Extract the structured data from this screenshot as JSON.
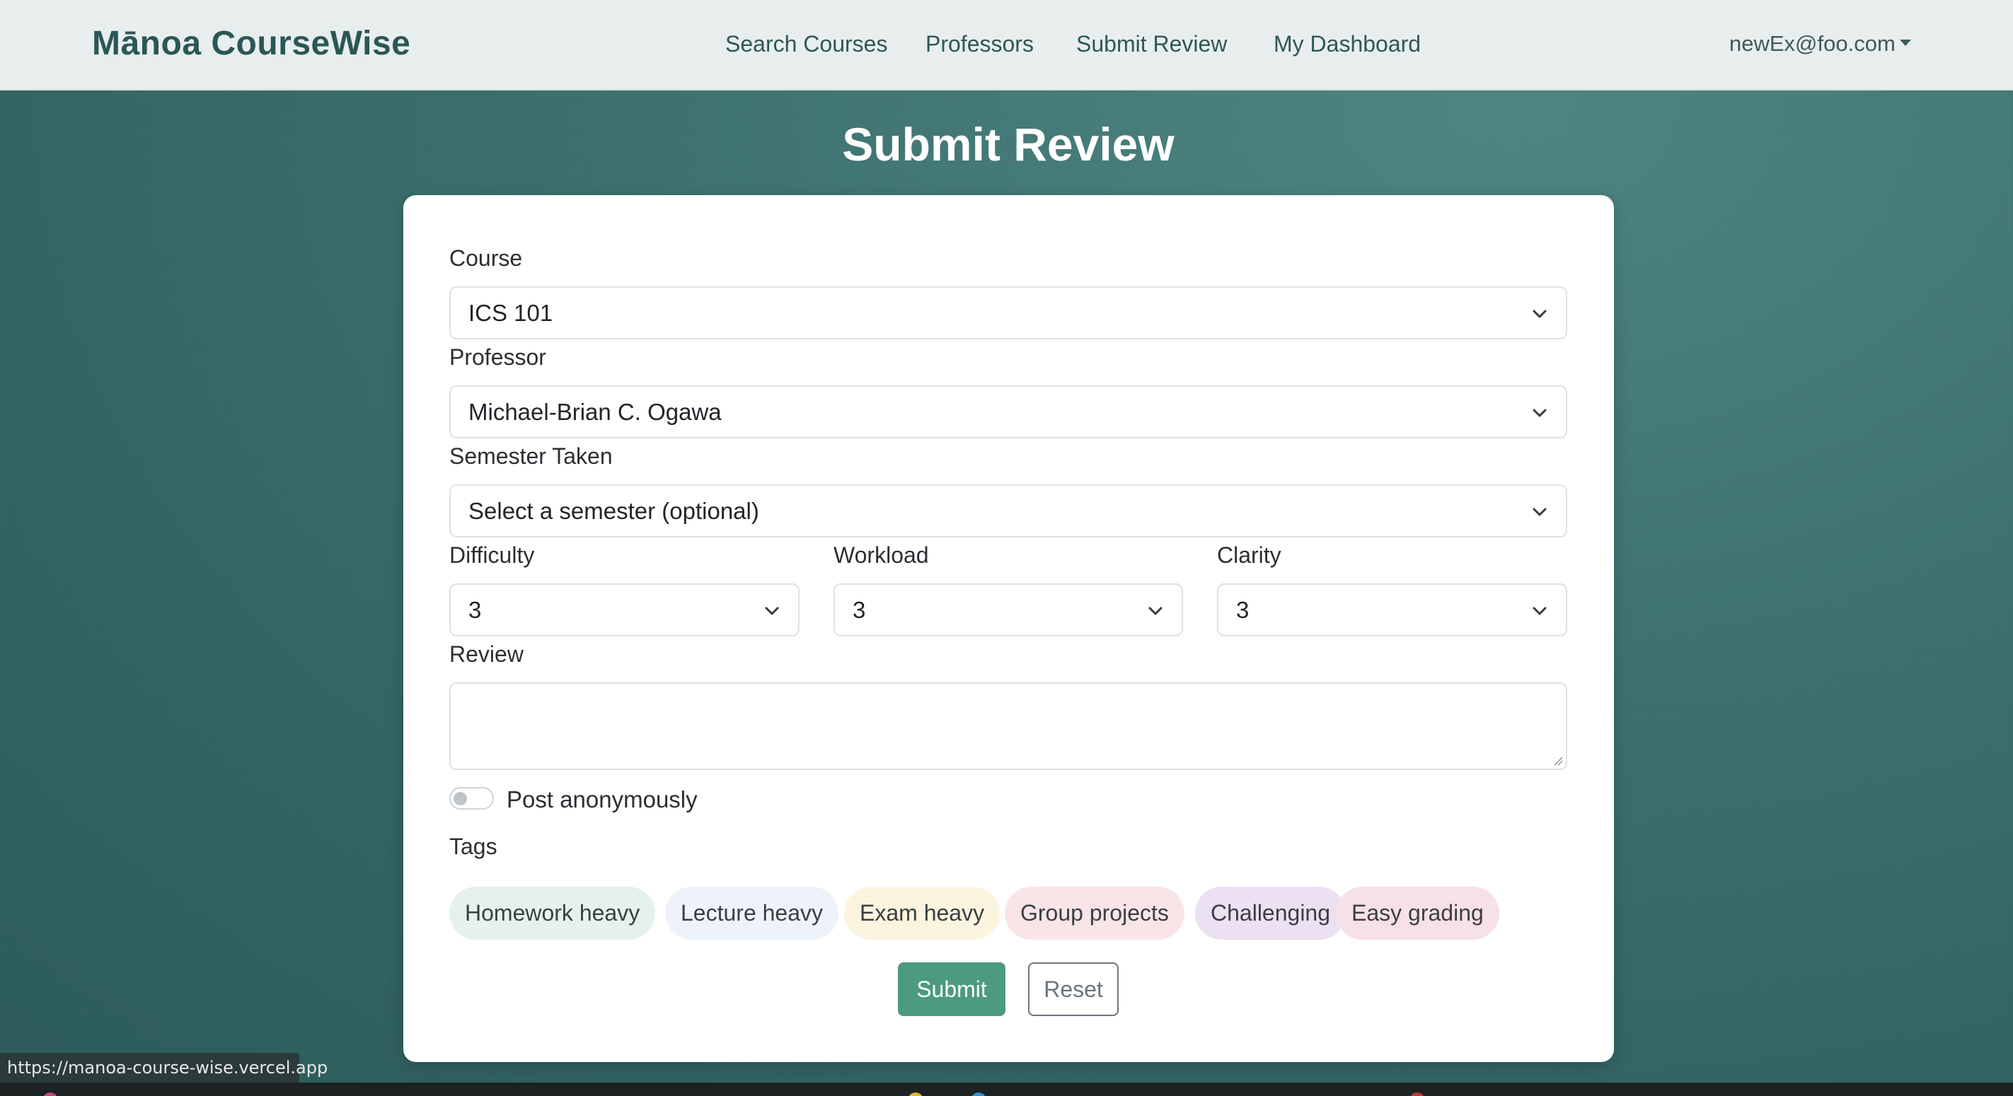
{
  "navbar": {
    "brand": "Mānoa CourseWise",
    "links": [
      "Search Courses",
      "Professors",
      "Submit Review",
      "My Dashboard"
    ],
    "user": "newEx@foo.com"
  },
  "page": {
    "title": "Submit Review"
  },
  "form": {
    "course": {
      "label": "Course",
      "value": "ICS 101"
    },
    "professor": {
      "label": "Professor",
      "value": "Michael-Brian C. Ogawa"
    },
    "semester": {
      "label": "Semester Taken",
      "value": "Select a semester (optional)"
    },
    "difficulty": {
      "label": "Difficulty",
      "value": "3"
    },
    "workload": {
      "label": "Workload",
      "value": "3"
    },
    "clarity": {
      "label": "Clarity",
      "value": "3"
    },
    "review": {
      "label": "Review",
      "value": ""
    },
    "anonymous": {
      "label": "Post anonymously",
      "checked": false
    },
    "tags_label": "Tags",
    "tags": [
      {
        "label": "Homework heavy",
        "color": "#e6f1ec"
      },
      {
        "label": "Lecture heavy",
        "color": "#eef3fb"
      },
      {
        "label": "Exam heavy",
        "color": "#fbf5df"
      },
      {
        "label": "Group projects",
        "color": "#f9e5e8"
      },
      {
        "label": "Challenging",
        "color": "#ece0f3"
      },
      {
        "label": "Easy grading",
        "color": "#f7e0e6"
      }
    ],
    "submit_label": "Submit",
    "reset_label": "Reset"
  },
  "status_bar": {
    "url": "https://manoa-course-wise.vercel.app"
  },
  "colors": {
    "accent": "#4c9a80",
    "brand": "#2a5755",
    "background": "#3f7472"
  },
  "icons": [
    "chevron-down-icon",
    "caret-down-icon",
    "resize-grip-icon"
  ]
}
